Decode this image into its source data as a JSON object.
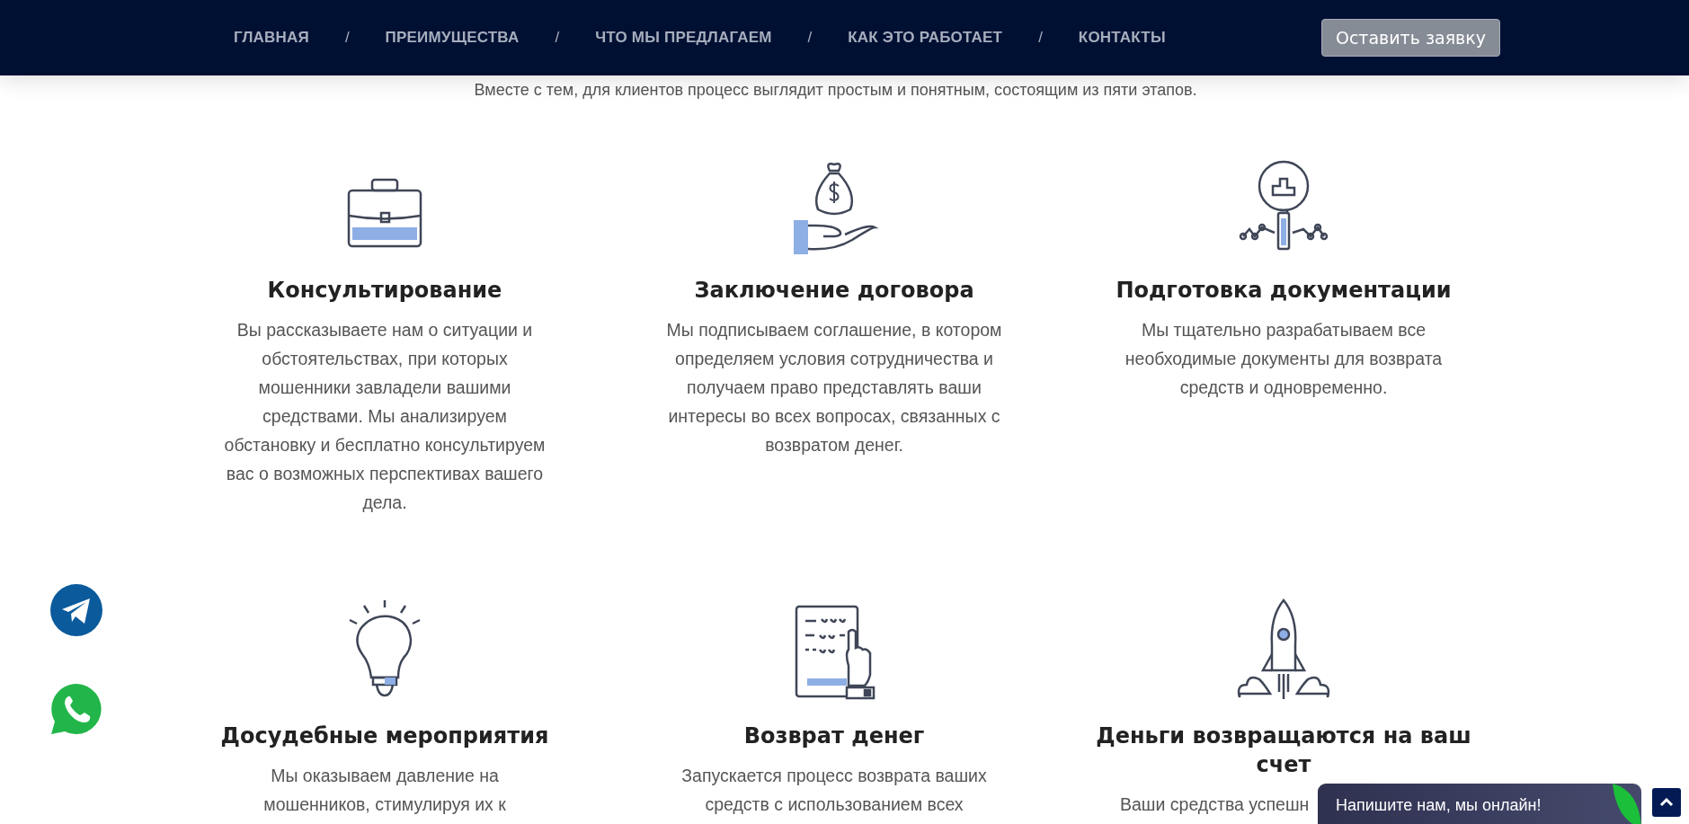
{
  "nav": {
    "items": [
      {
        "kind": "link",
        "text": "ГЛАВНАЯ"
      },
      {
        "kind": "separator",
        "text": "/"
      },
      {
        "kind": "link",
        "text": "ПРЕИМУЩЕСТВА"
      },
      {
        "kind": "separator",
        "text": "/"
      },
      {
        "kind": "link",
        "text": "ЧТО МЫ ПРЕДЛАГАЕМ"
      },
      {
        "kind": "separator",
        "text": "/"
      },
      {
        "kind": "link",
        "text": "КАК ЭТО РАБОТАЕТ"
      },
      {
        "kind": "separator",
        "text": "/"
      },
      {
        "kind": "link",
        "text": "КОНТАКТЫ"
      }
    ],
    "cta": "Оставить заявку"
  },
  "intro": "Вместе с тем, для клиентов процесс выглядит простым и понятным, состоящим из пяти этапов.",
  "steps": [
    {
      "kind": "briefcase",
      "title": "Консультирование",
      "text": "Вы рассказываете нам о ситуации и обстоятельствах, при которых мошенники завладели вашими средствами. Мы анализируем обстановку и бесплатно консультируем вас о возможных перспективах вашего дела."
    },
    {
      "kind": "money",
      "title": "Заключение договора",
      "text": "Мы подписываем соглашение, в котором определяем условия сотрудничества и получаем право представлять ваши интересы во всех вопросах, связанных с возвратом денег."
    },
    {
      "kind": "magnifier",
      "title": "Подготовка документации",
      "text": "Мы тщательно разрабатываем все необходимые документы для возврата средств и одновременно."
    },
    {
      "kind": "bulb",
      "title": "Досудебные мероприятия",
      "text": "Мы оказываем давление на мошенников, стимулируя их к"
    },
    {
      "kind": "document",
      "title": "Возврат денег",
      "text": "Запускается процесс возврата ваших средств с использованием всех"
    },
    {
      "kind": "rocket",
      "title": "Деньги возвращаются на ваш счет",
      "text": "Ваши средства успешн"
    }
  ],
  "chat": "Напишите нам, мы онлайн!"
}
